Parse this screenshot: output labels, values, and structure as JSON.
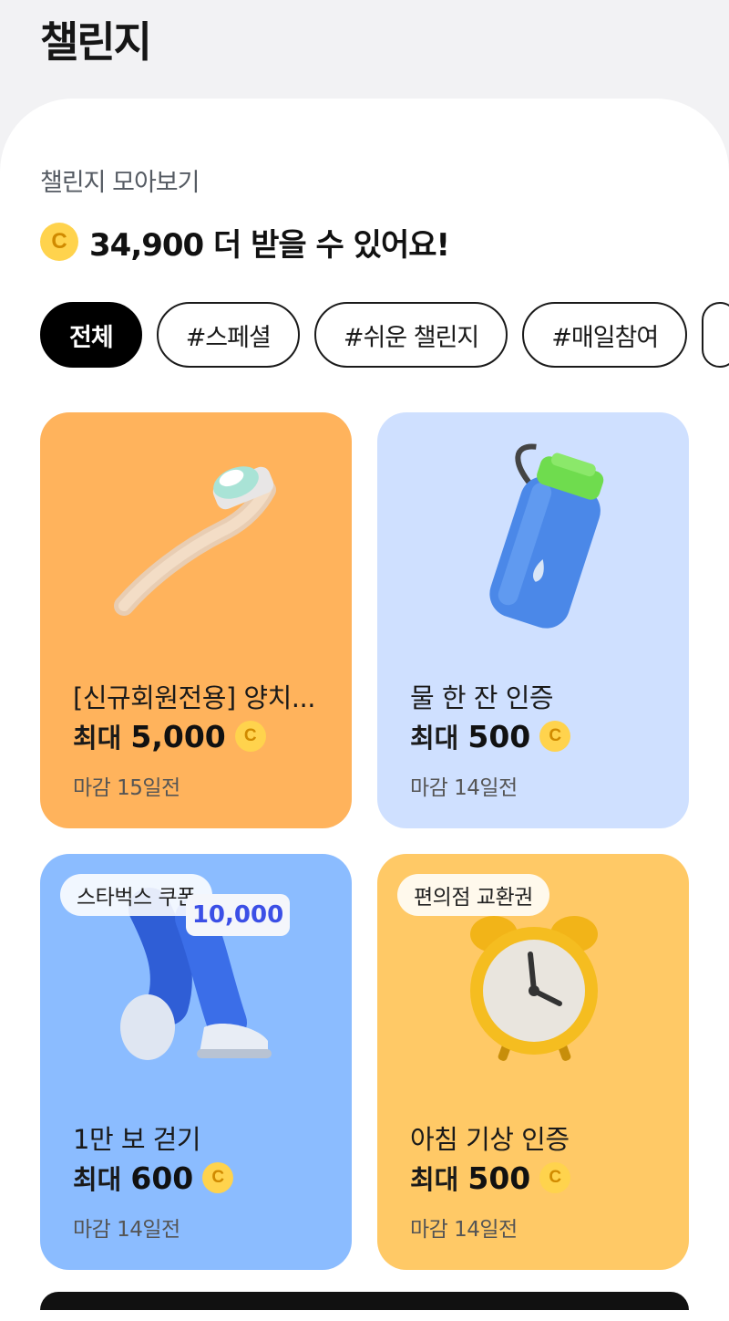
{
  "header": {
    "title": "챌린지"
  },
  "section": {
    "subtitle": "챌린지 모아보기",
    "coin_symbol": "C",
    "headline": "34,900 더 받을 수 있어요!"
  },
  "filters": {
    "active": "전체",
    "items": [
      "전체",
      "#스페셜",
      "#쉬운 챌린지",
      "#매일참여"
    ]
  },
  "cards": [
    {
      "title": "[신규회원전용] 양치...",
      "reward_prefix": "최대",
      "reward_amount": "5,000",
      "deadline": "마감 15일전",
      "bg": "#ffb35c",
      "icon": "toothbrush-icon"
    },
    {
      "title": "물 한 잔 인증",
      "reward_prefix": "최대",
      "reward_amount": "500",
      "deadline": "마감 14일전",
      "bg": "#cfe0ff",
      "icon": "water-bottle-icon"
    },
    {
      "title": "1만 보 걷기",
      "reward_prefix": "최대",
      "reward_amount": "600",
      "deadline": "마감 14일전",
      "badge": "스타벅스 쿠폰",
      "step_bubble": "10,000",
      "bg": "#8bbcff",
      "icon": "walking-legs-icon"
    },
    {
      "title": "아침 기상 인증",
      "reward_prefix": "최대",
      "reward_amount": "500",
      "deadline": "마감 14일전",
      "badge": "편의점 교환권",
      "bg": "#ffc966",
      "icon": "alarm-clock-icon"
    }
  ],
  "colors": {
    "coin": "#ffd34d",
    "coin_text": "#d08a00",
    "active_chip": "#000000"
  }
}
